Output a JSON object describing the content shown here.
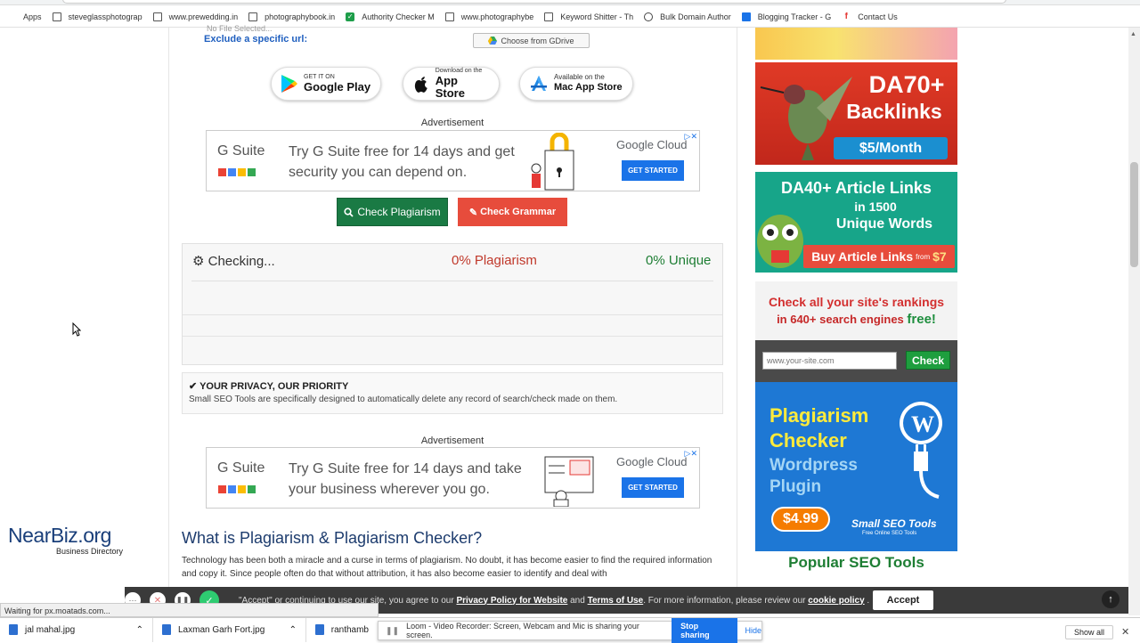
{
  "bookmarks": {
    "apps": "Apps",
    "items": [
      {
        "label": "steveglassphotograp",
        "icon": "doc"
      },
      {
        "label": "www.prewedding.in",
        "icon": "doc"
      },
      {
        "label": "photographybook.in",
        "icon": "doc"
      },
      {
        "label": "Authority Checker M",
        "icon": "check"
      },
      {
        "label": "www.photographybe",
        "icon": "doc"
      },
      {
        "label": "Keyword Shitter - Th",
        "icon": "doc"
      },
      {
        "label": "Bulk Domain Author",
        "icon": "bd"
      },
      {
        "label": "Blogging Tracker - G",
        "icon": "grid"
      },
      {
        "label": "Contact Us",
        "icon": "fb"
      }
    ]
  },
  "form": {
    "no_file": "No File Selected...",
    "exclude_label": "Exclude a specific url:",
    "gdrive_button": "Choose from GDrive"
  },
  "stores": {
    "google": {
      "small": "GET IT ON",
      "big": "Google Play"
    },
    "apple": {
      "small": "Download on the",
      "big": "App Store"
    },
    "mac": {
      "small": "Available on the",
      "big": "Mac App Store"
    }
  },
  "ad1": {
    "label": "Advertisement",
    "brand": "G Suite",
    "text": "Try G Suite free for 14 days and get security you can depend on.",
    "cloud": "Google Cloud",
    "cta": "GET STARTED"
  },
  "ad2": {
    "label": "Advertisement",
    "brand": "G Suite",
    "text": "Try G Suite free for 14 days and take your business wherever you go.",
    "cloud": "Google Cloud",
    "cta": "GET STARTED"
  },
  "actions": {
    "check": "Check Plagiarism",
    "grammar": "Check Grammar"
  },
  "result": {
    "status": "Checking...",
    "plagiarism": "0% Plagiarism",
    "unique": "0% Unique"
  },
  "privacy": {
    "title": "YOUR PRIVACY, OUR PRIORITY",
    "text": "Small SEO Tools are specifically designed to automatically delete any record of search/check made on them."
  },
  "article": {
    "heading": "What is Plagiarism & Plagiarism Checker?",
    "body": "Technology has been both a miracle and a curse in terms of plagiarism. No doubt, it has become easier to find the required information and copy it. Since people often do that without attribution, it has also become easier to identify and deal with"
  },
  "sidebar": {
    "da70": {
      "title": "DA70+",
      "sub": "Backlinks",
      "price": "$5/Month"
    },
    "da40": {
      "title": "DA40+ Article Links",
      "sub1": "in 1500",
      "sub2": "Unique Words",
      "cta": "Buy Article Links",
      "from": "from",
      "price": "$7"
    },
    "rank": {
      "line1": "Check all your site's rankings",
      "line2": "in 640+ search engines",
      "free": "free!",
      "placeholder": "www.your-site.com",
      "button": "Check"
    },
    "plugin": {
      "l1": "Plagiarism",
      "l2": "Checker",
      "l3": "Wordpress",
      "l4": "Plugin",
      "price": "$4.99",
      "brand": "Small SEO Tools",
      "tagline": "Free Online SEO Tools"
    },
    "popular": "Popular SEO Tools"
  },
  "cookie": {
    "pre": "\"Accept\" or continuing to use our site, you agree to our",
    "link1": "Privacy Policy for Website",
    "and": "and",
    "link2": "Terms of Use",
    "mid": ". For more information, please review our",
    "link3": "cookie policy",
    "accept": "Accept"
  },
  "status_text": "Waiting for px.moatads.com...",
  "downloads": [
    {
      "name": "jal mahal.jpg"
    },
    {
      "name": "Laxman Garh Fort.jpg"
    },
    {
      "name": "ranthamb"
    }
  ],
  "loom": {
    "text": "Loom - Video Recorder: Screen, Webcam and Mic is sharing your screen.",
    "stop": "Stop sharing",
    "hide": "Hide"
  },
  "show_all": "Show all",
  "nearbiz": {
    "name": "NearBiz.org",
    "sub": "Business Directory"
  },
  "colors": {
    "check_green": "#1a7a44",
    "grammar_red": "#e74c3c",
    "link_blue": "#1f5fbf"
  }
}
